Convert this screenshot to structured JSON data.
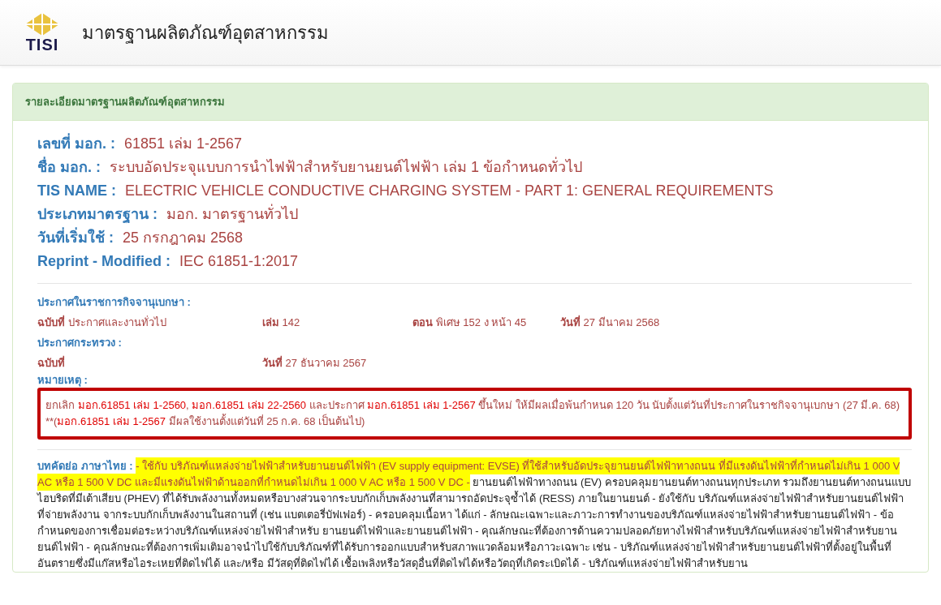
{
  "header": {
    "logo_text": "TISI",
    "title": "มาตรฐานผลิตภัณฑ์อุตสาหกรรม"
  },
  "panel": {
    "title": "รายละเอียดมาตรฐานผลิตภัณฑ์อุตสาหกรรม"
  },
  "details": [
    {
      "label": "เลขที่ มอก. :",
      "value": "61851 เล่ม 1-2567"
    },
    {
      "label": "ชื่อ มอก. :",
      "value": "ระบบอัดประจุแบบการนำไฟฟ้าสำหรับยานยนต์ไฟฟ้า เล่ม 1 ข้อกำหนดทั่วไป"
    },
    {
      "label": "TIS NAME :",
      "value": "ELECTRIC VEHICLE CONDUCTIVE CHARGING SYSTEM - PART 1: GENERAL REQUIREMENTS"
    },
    {
      "label": "ประเภทมาตรฐาน :",
      "value": "มอก. มาตรฐานทั่วไป"
    },
    {
      "label": "วันที่เริ่มใช้ :",
      "value": "25 กรกฎาคม 2568"
    },
    {
      "label": "Reprint - Modified :",
      "value": "IEC 61851-1:2017"
    }
  ],
  "gazette": {
    "title": "ประกาศในราชการกิจจานุเบกษา :",
    "cells": [
      "**ฉบับที่** ประกาศและงานทั่วไป",
      "**เล่ม** 142",
      "**ตอน** พิเศษ 152 ง หน้า 45",
      "**วันที่**  27 มีนาคม 2568"
    ]
  },
  "ministry": {
    "title": "ประกาศกระทรวง :",
    "cells": [
      "**ฉบับที่**",
      "**วันที่** 27 ธันวาคม 2567"
    ]
  },
  "remark": {
    "title": "หมายเหตุ :",
    "segments": [
      {
        "text": "ยกเลิก ",
        "bold": false
      },
      {
        "text": "มอก.61851 เล่ม 1-2560",
        "bold": true
      },
      {
        "text": ", ",
        "bold": false
      },
      {
        "text": "มอก.61851 เล่ม 22-2560",
        "bold": true
      },
      {
        "text": " และประกาศ ",
        "bold": false
      },
      {
        "text": "มอก.61851 เล่ม 1-2567",
        "bold": true
      },
      {
        "text": " ขึ้นใหม่ ให้มีผลเมื่อพ้นกำหนด 120 วัน นับตั้งแต่วันที่ประกาศในราชกิจจานุเบกษา (27 มี.ค. 68) **(",
        "bold": false
      },
      {
        "text": "มอก.61851 เล่ม 1-2567",
        "bold": true
      },
      {
        "text": " มีผลใช้งานตั้งแต่วันที่ 25 ก.ค. 68 เป็นต้นไป)",
        "bold": false
      }
    ]
  },
  "abstract": {
    "label": "บทคัดย่อ ภาษาไทย :",
    "highlighted": "- ใช้กับ บริภัณฑ์แหล่งจ่ายไฟฟ้าสำหรับยานยนต์ไฟฟ้า (EV supply equipment: EVSE) ที่ใช้สำหรับอัดประจุยานยนต์ไฟฟ้าทางถนน ที่มีแรงดันไฟฟ้าที่กำหนดไม่เกิน 1 000 V AC หรือ 1 500 V DC และมีแรงดันไฟฟ้าด้านออกที่กำหนดไม่เกิน 1 000 V AC หรือ 1 500 V DC -",
    "text": "ยานยนต์ไฟฟ้าทางถนน (EV) ครอบคลุมยานยนต์ทางถนนทุกประเภท รวมถึงยานยนต์ทางถนนแบบไฮบริดที่มีเต้าเสียบ (PHEV) ที่ได้รับพลังงานทั้งหมดหรือบางส่วนจากระบบกักเก็บพลังงานที่สามารถอัดประจุซ้ำได้ (RESS) ภายในยานยนต์ - ยังใช้กับ บริภัณฑ์แหล่งจ่ายไฟฟ้าสำหรับยานยนต์ไฟฟ้า ที่จ่ายพลังงาน จากระบบกักเก็บพลังงานในสถานที่ (เช่น แบตเตอรี่บัฟเฟอร์) - ครอบคลุมเนื้อหา ได้แก่ - ลักษณะเฉพาะและภาวะการทำงานของบริภัณฑ์แหล่งจ่ายไฟฟ้าสำหรับยานยนต์ไฟฟ้า - ข้อกำหนดของการเชื่อมต่อระหว่างบริภัณฑ์แหล่งจ่ายไฟฟ้าสำหรับ ยานยนต์ไฟฟ้าและยานยนต์ไฟฟ้า - คุณลักษณะที่ต้องการด้านความปลอดภัยทางไฟฟ้าสำหรับบริภัณฑ์แหล่งจ่ายไฟฟ้าสำหรับยานยนต์ไฟฟ้า - คุณลักษณะที่ต้องการเพิ่มเติมอาจนำไปใช้กับบริภัณฑ์ที่ได้รับการออกแบบสำหรับสภาพแวดล้อมหรือภาวะเฉพาะ เช่น - บริภัณฑ์แหล่งจ่ายไฟฟ้าสำหรับยานยนต์ไฟฟ้าที่ตั้งอยู่ในพื้นที่อันตรายซึ่งมีแก๊สหรือไอระเหยที่ติดไฟได้ และ/หรือ มีวัสดุที่ติดไฟได้ เชื้อเพลิงหรือวัสดุอื่นที่ติดไฟได้หรือวัตถุที่เกิดระเบิดได้ - บริภัณฑ์แหล่งจ่ายไฟฟ้าสำหรับยาน"
  }
}
